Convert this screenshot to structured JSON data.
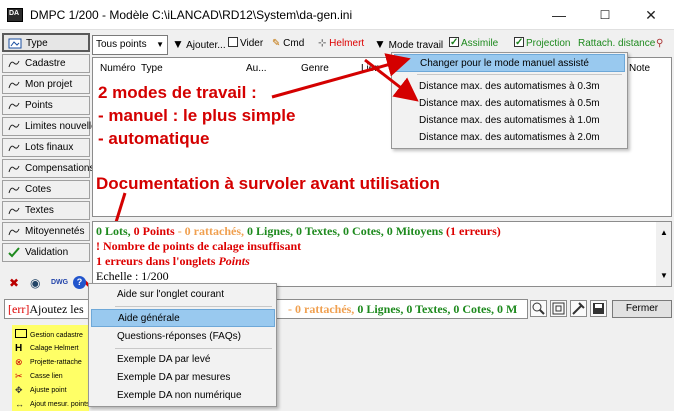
{
  "window": {
    "title": "DMPC 1/200 - Modèle C:\\iLANCAD\\RD12\\System\\da-gen.ini",
    "min": "—",
    "max": "☐",
    "close": "✕"
  },
  "tabs": [
    {
      "label": "Type"
    },
    {
      "label": "Cadastre"
    },
    {
      "label": "Mon projet"
    },
    {
      "label": "Points"
    },
    {
      "label": "Limites nouvelles"
    },
    {
      "label": "Lots finaux"
    },
    {
      "label": "Compensations"
    },
    {
      "label": "Cotes"
    },
    {
      "label": "Textes"
    },
    {
      "label": "Mitoyennetés"
    },
    {
      "label": "Validation"
    }
  ],
  "toolbar": {
    "combo_value": "Tous points",
    "ajouter": "Ajouter...",
    "vider": "Vider",
    "cmd": "Cmd",
    "helmert": "Helmert",
    "mode_travail": "Mode travail",
    "assimile": "Assimile",
    "projection": "Projection",
    "rattach": "Rattach. distance"
  },
  "columns": [
    "Numéro",
    "Type",
    "Au...",
    "Genre",
    "Lien",
    "Note"
  ],
  "mode_menu": [
    "Changer pour le mode manuel assisté",
    "Distance max. des automatismes à 0.3m",
    "Distance max. des automatismes à 0.5m",
    "Distance max. des automatismes à 1.0m",
    "Distance max. des automatismes à 2.0m"
  ],
  "annotations": {
    "line1": "2 modes de travail :",
    "line2": "- manuel : le plus simple",
    "line3": "- automatique",
    "doc": "Documentation à survoler avant utilisation"
  },
  "messages": {
    "summary": {
      "lots": "0 Lots, ",
      "points": "0 Points",
      "rattaches": " - 0 rattachés, ",
      "lignes": "0 Lignes, ",
      "textes": "0 Textes, ",
      "cotes": "0 Cotes, ",
      "mitoyens": "0 Mitoyens ",
      "erreurs": "(1 erreurs)"
    },
    "warn1": "! Nombre de points de calage insuffisant",
    "warn2_pre": "1 erreurs dans l'onglets ",
    "warn2_em": "Points",
    "echelle": "Echelle : 1/200"
  },
  "cmdline": {
    "prefix": "[err]",
    "text": "Ajoutez les",
    "rattaches": "- 0 rattachés, ",
    "rest_green": "0 Lignes, 0 Textes, 0 Cotes, 0 M"
  },
  "help_menu": [
    "Aide sur l'onglet courant",
    "Aide générale",
    "Questions-réponses (FAQs)",
    "Exemple DA par levé",
    "Exemple DA par mesures",
    "Exemple DA non numérique"
  ],
  "legend": [
    "Gestion cadastre",
    "Calage Helmert",
    "Projette-rattache",
    "Casse lien",
    "Ajuste point",
    "Ajout mesur. points"
  ],
  "fermer": "Fermer",
  "colors": {
    "annotation_red": "#d40000",
    "menu_highlight": "#99c9ef",
    "legend_bg": "#ffff66",
    "green_text": "#1e8a1e",
    "orange_text": "#f0a050"
  }
}
